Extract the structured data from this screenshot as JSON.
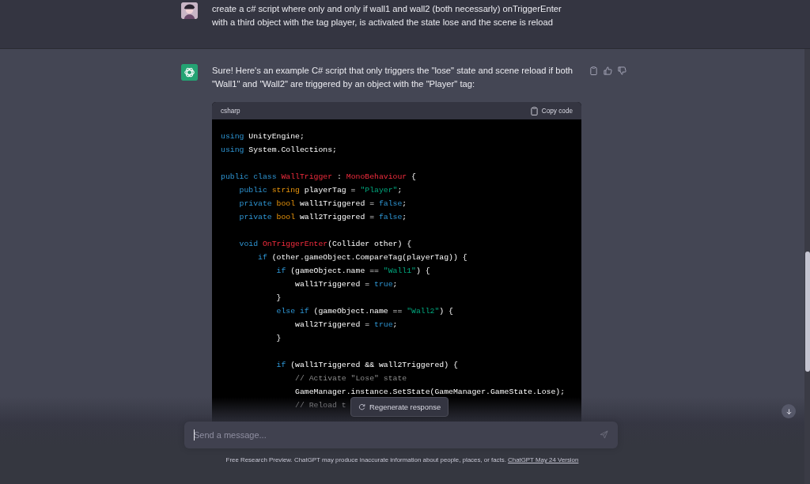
{
  "user_message": {
    "text": "create a c# script where only and only if wall1 and wall2 (both necessarly) onTriggerEnter with a third object with the tag player, is activated the state lose and the scene is reload"
  },
  "assistant_message": {
    "text": "Sure! Here's an example C# script that only triggers the \"lose\" state and scene reload if both \"Wall1\" and \"Wall2\" are triggered by an object with the \"Player\" tag:"
  },
  "code_block": {
    "language": "csharp",
    "copy_label": "Copy code",
    "lines": [
      {
        "kind": "code",
        "tokens": [
          {
            "text": "using",
            "kind": "keyword"
          },
          {
            "text": " UnityEngine;",
            "kind": "plain"
          }
        ]
      },
      {
        "kind": "code",
        "tokens": [
          {
            "text": "using",
            "kind": "keyword"
          },
          {
            "text": " System.Collections;",
            "kind": "plain"
          }
        ]
      },
      {
        "kind": "blank"
      },
      {
        "kind": "code",
        "tokens": [
          {
            "text": "public class ",
            "kind": "keyword"
          },
          {
            "text": "WallTrigger",
            "kind": "class"
          },
          {
            "text": " : ",
            "kind": "plain"
          },
          {
            "text": "MonoBehaviour",
            "kind": "class"
          },
          {
            "text": " {",
            "kind": "plain"
          }
        ]
      },
      {
        "kind": "code",
        "tokens": [
          {
            "text": "    public ",
            "kind": "keyword"
          },
          {
            "text": "string",
            "kind": "type"
          },
          {
            "text": " playerTag = ",
            "kind": "plain"
          },
          {
            "text": "\"Player\"",
            "kind": "string"
          },
          {
            "text": ";",
            "kind": "plain"
          }
        ]
      },
      {
        "kind": "code",
        "tokens": [
          {
            "text": "    private ",
            "kind": "keyword"
          },
          {
            "text": "bool",
            "kind": "type"
          },
          {
            "text": " wall1Triggered = ",
            "kind": "plain"
          },
          {
            "text": "false",
            "kind": "keyword"
          },
          {
            "text": ";",
            "kind": "plain"
          }
        ]
      },
      {
        "kind": "code",
        "tokens": [
          {
            "text": "    private ",
            "kind": "keyword"
          },
          {
            "text": "bool",
            "kind": "type"
          },
          {
            "text": " wall2Triggered = ",
            "kind": "plain"
          },
          {
            "text": "false",
            "kind": "keyword"
          },
          {
            "text": ";",
            "kind": "plain"
          }
        ]
      },
      {
        "kind": "blank"
      },
      {
        "kind": "code",
        "tokens": [
          {
            "text": "    void ",
            "kind": "keyword"
          },
          {
            "text": "OnTriggerEnter",
            "kind": "class"
          },
          {
            "text": "(Collider other) {",
            "kind": "plain"
          }
        ]
      },
      {
        "kind": "code",
        "tokens": [
          {
            "text": "        if",
            "kind": "keyword"
          },
          {
            "text": " (other.gameObject.CompareTag(playerTag)) {",
            "kind": "plain"
          }
        ]
      },
      {
        "kind": "code",
        "tokens": [
          {
            "text": "            if",
            "kind": "keyword"
          },
          {
            "text": " (gameObject.name == ",
            "kind": "plain"
          },
          {
            "text": "\"Wall1\"",
            "kind": "string"
          },
          {
            "text": ") {",
            "kind": "plain"
          }
        ]
      },
      {
        "kind": "code",
        "tokens": [
          {
            "text": "                wall1Triggered = ",
            "kind": "plain"
          },
          {
            "text": "true",
            "kind": "keyword"
          },
          {
            "text": ";",
            "kind": "plain"
          }
        ]
      },
      {
        "kind": "code",
        "tokens": [
          {
            "text": "            }",
            "kind": "plain"
          }
        ]
      },
      {
        "kind": "code",
        "tokens": [
          {
            "text": "            else if",
            "kind": "keyword"
          },
          {
            "text": " (gameObject.name == ",
            "kind": "plain"
          },
          {
            "text": "\"Wall2\"",
            "kind": "string"
          },
          {
            "text": ") {",
            "kind": "plain"
          }
        ]
      },
      {
        "kind": "code",
        "tokens": [
          {
            "text": "                wall2Triggered = ",
            "kind": "plain"
          },
          {
            "text": "true",
            "kind": "keyword"
          },
          {
            "text": ";",
            "kind": "plain"
          }
        ]
      },
      {
        "kind": "code",
        "tokens": [
          {
            "text": "            }",
            "kind": "plain"
          }
        ]
      },
      {
        "kind": "blank"
      },
      {
        "kind": "code",
        "tokens": [
          {
            "text": "            if",
            "kind": "keyword"
          },
          {
            "text": " (wall1Triggered && wall2Triggered) {",
            "kind": "plain"
          }
        ]
      },
      {
        "kind": "code",
        "tokens": [
          {
            "text": "                // Activate \"Lose\" state",
            "kind": "comment"
          }
        ]
      },
      {
        "kind": "code",
        "tokens": [
          {
            "text": "                GameManager.instance.SetState(GameManager.GameState.Lose);",
            "kind": "plain"
          }
        ]
      },
      {
        "kind": "code",
        "tokens": [
          {
            "text": "                // Reload t",
            "kind": "comment"
          }
        ]
      }
    ]
  },
  "regenerate_button": {
    "label": "Regenerate response"
  },
  "composer": {
    "placeholder": "Send a message..."
  },
  "footer": {
    "text": "Free Research Preview. ChatGPT may produce inaccurate information about people, places, or facts.",
    "link": "ChatGPT May 24 Version"
  }
}
